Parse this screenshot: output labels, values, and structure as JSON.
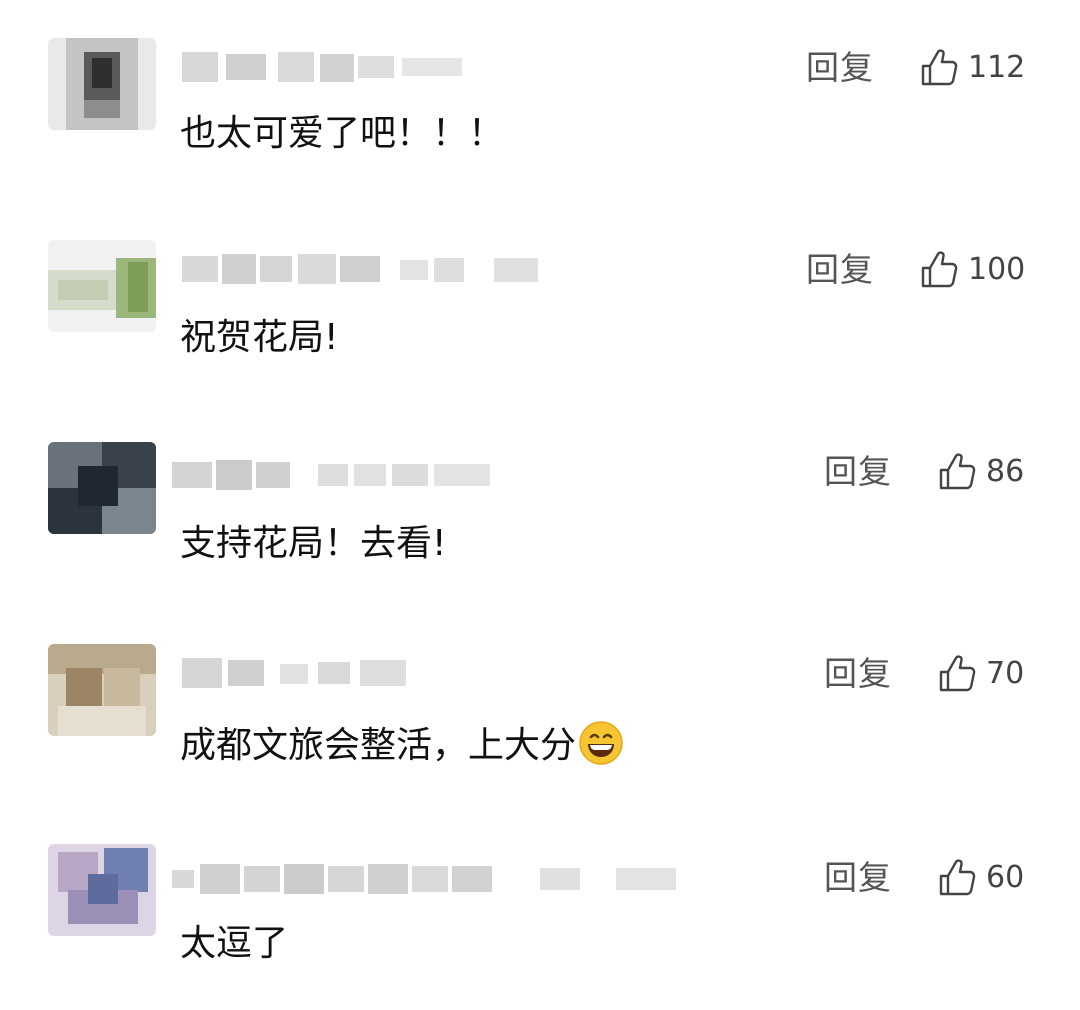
{
  "comments": [
    {
      "text": "也太可爱了吧！！！",
      "reply_label": "回复",
      "likes": "112",
      "avatar_colors": [
        "#c9c9c9",
        "#9a9a9a",
        "#3d3d3d",
        "#b6b6b6"
      ]
    },
    {
      "text": "祝贺花局!",
      "reply_label": "回复",
      "likes": "100",
      "avatar_colors": [
        "#e6e6e6",
        "#b9c4a5",
        "#8aa86a",
        "#d8d8d8"
      ]
    },
    {
      "text": "支持花局！去看!",
      "reply_label": "回复",
      "likes": "86",
      "avatar_colors": [
        "#6f7781",
        "#3a4149",
        "#25303a",
        "#9aa4ad"
      ]
    },
    {
      "text": "成都文旅会整活，上大分",
      "reply_label": "回复",
      "likes": "70",
      "emoji": "grinning-face-emoji",
      "avatar_colors": [
        "#c8b9a2",
        "#a18a6c",
        "#d7cdb9",
        "#8f7a60"
      ]
    },
    {
      "text": "太逗了",
      "reply_label": "回复",
      "likes": "60",
      "avatar_colors": [
        "#c9c0d6",
        "#7b86b4",
        "#a49ab8",
        "#e2dbe8"
      ]
    }
  ],
  "icons": {
    "like": "thumbs-up-icon",
    "emoji": "grinning-face-emoji"
  },
  "colors": {
    "text": "#111111",
    "meta": "#555555",
    "blur": "#d9d9d9"
  }
}
